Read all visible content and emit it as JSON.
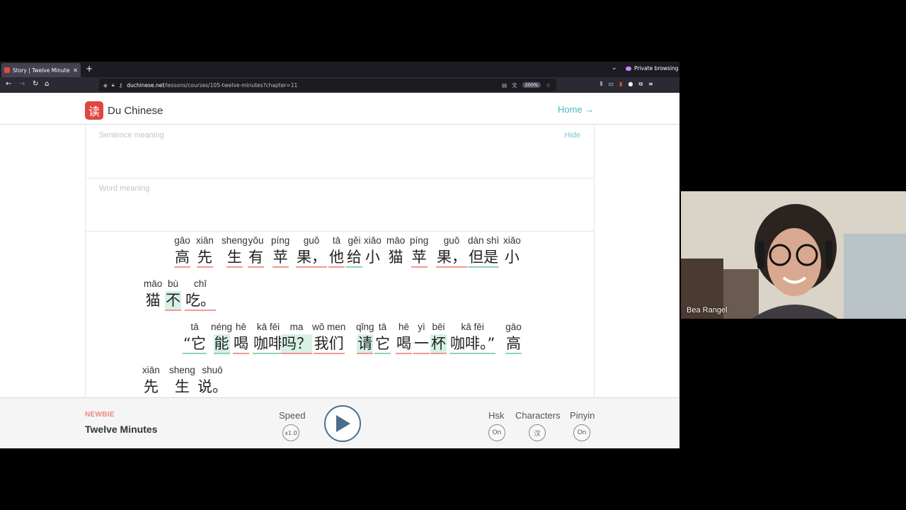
{
  "browser": {
    "tab_title": "Story | Twelve Minutes | D",
    "new_tab_label": "+",
    "private_label": "Private browsing",
    "url_host": "duchinese.net",
    "url_path": "/lessons/courses/105-twelve-minutes?chapter=11",
    "zoom": "200%"
  },
  "site": {
    "brand": "Du Chinese",
    "home_link": "Home →"
  },
  "panels": {
    "sentence_meaning_label": "Sentence meaning",
    "hide_label": "Hide",
    "word_meaning_label": "Word meaning"
  },
  "story": {
    "words": [
      {
        "py": "gāo",
        "hz": "高",
        "ul": "red"
      },
      {
        "py": "xiān",
        "hz": "先",
        "ul": "red"
      },
      {
        "py": "sheng",
        "hz": "生",
        "ul": "red"
      },
      {
        "py": "yǒu",
        "hz": "有",
        "ul": "red"
      },
      {
        "py": "píng",
        "hz": "苹",
        "ul": "red"
      },
      {
        "py": "guǒ",
        "hz": "果，",
        "ul": "red"
      },
      {
        "py": "tā",
        "hz": "他",
        "ul": "red"
      },
      {
        "py": "gěi",
        "hz": "给",
        "ul": "green"
      },
      {
        "py": "xiǎo",
        "hz": "小",
        "ul": ""
      },
      {
        "py": "māo",
        "hz": "猫",
        "ul": ""
      },
      {
        "py": "píng",
        "hz": "苹",
        "ul": "red"
      },
      {
        "py": "guǒ",
        "hz": "果，",
        "ul": "red"
      },
      {
        "py": "dàn shì",
        "hz": "但是",
        "ul": "green"
      },
      {
        "py": "xiǎo",
        "hz": "小",
        "ul": ""
      },
      {
        "py": "māo",
        "hz": "猫",
        "ul": ""
      },
      {
        "py": "bù",
        "hz": "不",
        "ul": "red",
        "hl": true
      },
      {
        "py": "chī",
        "hz": "吃。",
        "ul": "red"
      },
      {
        "py": "tā",
        "hz": "“它",
        "ul": "green"
      },
      {
        "py": "néng",
        "hz": "能",
        "ul": "green",
        "hl": true
      },
      {
        "py": "hē",
        "hz": "喝",
        "ul": "red"
      },
      {
        "py": "kā fēi",
        "hz": "咖啡",
        "ul": "green"
      },
      {
        "py": "ma",
        "hz": "吗？",
        "ul": "red",
        "hl": true
      },
      {
        "py": "wǒ men",
        "hz": "我们",
        "ul": "red"
      },
      {
        "py": "qǐng",
        "hz": "请",
        "ul": "red",
        "hl": true
      },
      {
        "py": "tā",
        "hz": "它",
        "ul": "green"
      },
      {
        "py": "hē",
        "hz": "喝",
        "ul": "red"
      },
      {
        "py": "yì",
        "hz": "一",
        "ul": "red"
      },
      {
        "py": "bēi",
        "hz": "杯",
        "ul": "red",
        "hl": true
      },
      {
        "py": "kā fēi",
        "hz": "咖啡。”",
        "ul": "green"
      },
      {
        "py": "gāo",
        "hz": "高",
        "ul": "green"
      },
      {
        "py": "xiān",
        "hz": "先",
        "ul": ""
      },
      {
        "py": "sheng",
        "hz": "生",
        "ul": ""
      },
      {
        "py": "shuō",
        "hz": "说。",
        "ul": ""
      }
    ]
  },
  "player": {
    "level": "NEWBIE",
    "title": "Twelve Minutes",
    "speed_label": "Speed",
    "speed_value": "x1.0",
    "hsk_label": "Hsk",
    "hsk_value": "On",
    "characters_label": "Characters",
    "characters_value": "汉",
    "pinyin_label": "Pinyin",
    "pinyin_value": "On"
  },
  "webcam": {
    "name": "Bea Rangel"
  }
}
